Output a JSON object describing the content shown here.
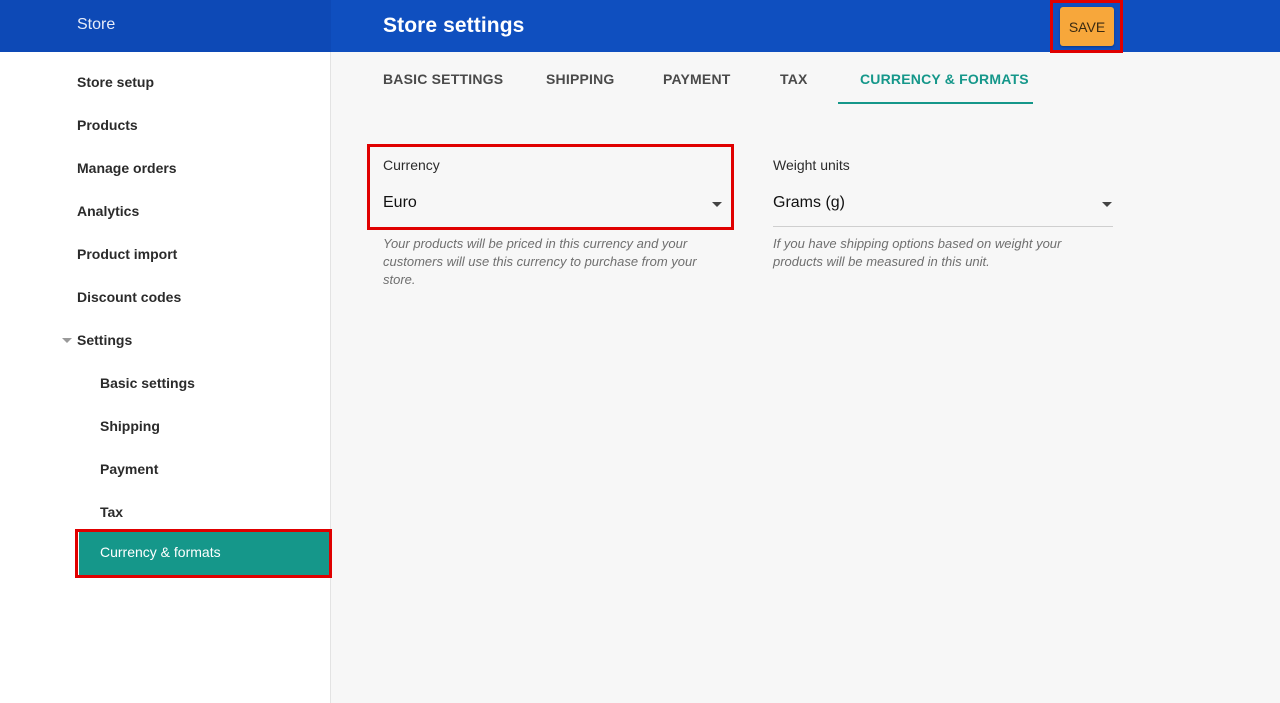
{
  "header": {
    "brand": "Store",
    "title": "Store settings",
    "save_label": "SAVE"
  },
  "sidebar": {
    "items": [
      {
        "label": "Store setup"
      },
      {
        "label": "Products"
      },
      {
        "label": "Manage orders"
      },
      {
        "label": "Analytics"
      },
      {
        "label": "Product import"
      },
      {
        "label": "Discount codes"
      }
    ],
    "settings_label": "Settings",
    "settings_children": [
      {
        "label": "Basic settings"
      },
      {
        "label": "Shipping"
      },
      {
        "label": "Payment"
      },
      {
        "label": "Tax"
      },
      {
        "label": "Currency & formats"
      }
    ]
  },
  "tabs": [
    {
      "label": "BASIC SETTINGS"
    },
    {
      "label": "SHIPPING"
    },
    {
      "label": "PAYMENT"
    },
    {
      "label": "TAX"
    },
    {
      "label": "CURRENCY & FORMATS"
    }
  ],
  "form": {
    "currency": {
      "label": "Currency",
      "value": "Euro",
      "helper": "Your products will be priced in this currency and your customers will use this currency to purchase from your store."
    },
    "weight": {
      "label": "Weight units",
      "value": "Grams (g)",
      "helper": "If you have shipping options based on weight your products will be measured in this unit."
    }
  },
  "colors": {
    "header_bg": "#0f4fbf",
    "accent": "#15978a",
    "save_button": "#f7a73b",
    "highlight_box": "#e00000"
  }
}
